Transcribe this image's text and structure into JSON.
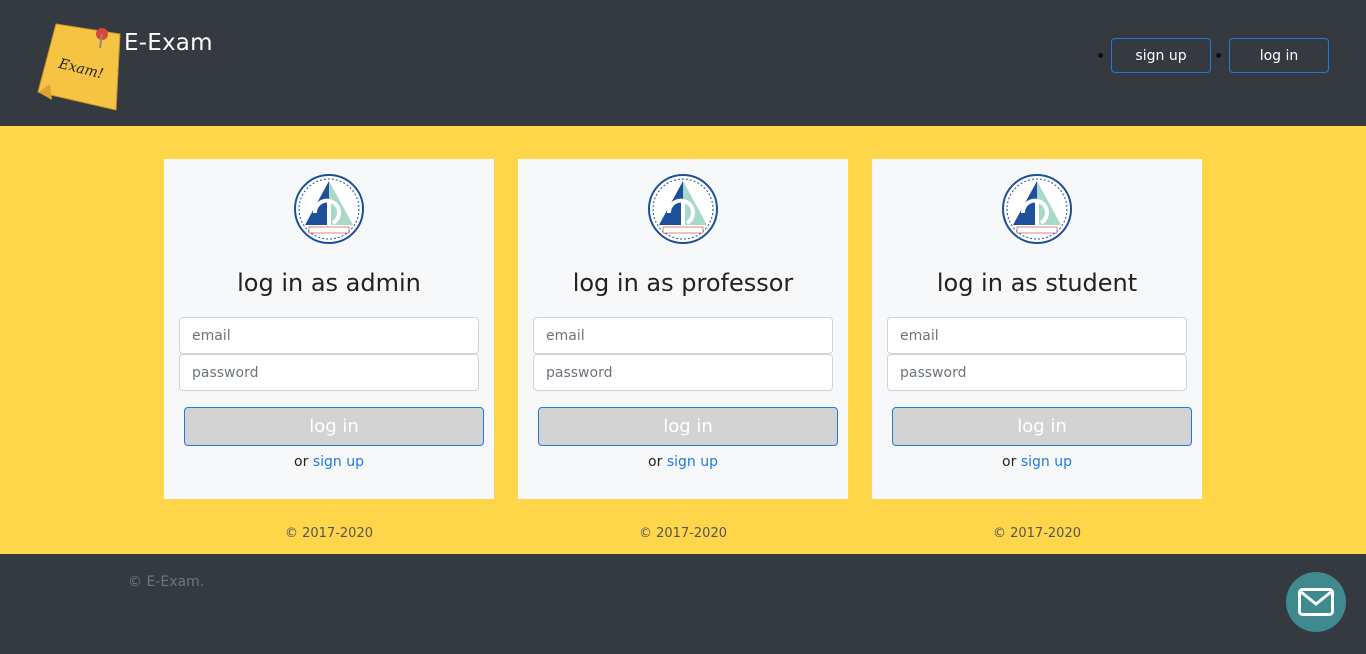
{
  "header": {
    "brand": "E-Exam",
    "logo_note_text": "Exam!",
    "nav": [
      {
        "label": "sign up"
      },
      {
        "label": "log in"
      }
    ]
  },
  "cards": [
    {
      "heading": "log in as admin",
      "email_placeholder": "email",
      "password_placeholder": "password",
      "button": "log in",
      "alt_prefix": "or",
      "alt_link": "sign up",
      "copyright": "© 2017-2020"
    },
    {
      "heading": "log in as professor",
      "email_placeholder": "email",
      "password_placeholder": "password",
      "button": "log in",
      "alt_prefix": "or",
      "alt_link": "sign up",
      "copyright": "© 2017-2020"
    },
    {
      "heading": "log in as student",
      "email_placeholder": "email",
      "password_placeholder": "password",
      "button": "log in",
      "alt_prefix": "or",
      "alt_link": "sign up",
      "copyright": "© 2017-2020"
    }
  ],
  "footer": {
    "text": "© E-Exam."
  },
  "icons": {
    "brand": "sticky-note-logo-icon",
    "seal": "university-seal-icon",
    "fab": "envelope-icon"
  },
  "colors": {
    "header_bg": "#343a40",
    "main_bg": "#ffd54a",
    "card_bg": "#f7f8fa",
    "accent": "#1f7ae0",
    "button_bg": "#d3d3d3",
    "fab_bg": "#3f8a8f"
  }
}
